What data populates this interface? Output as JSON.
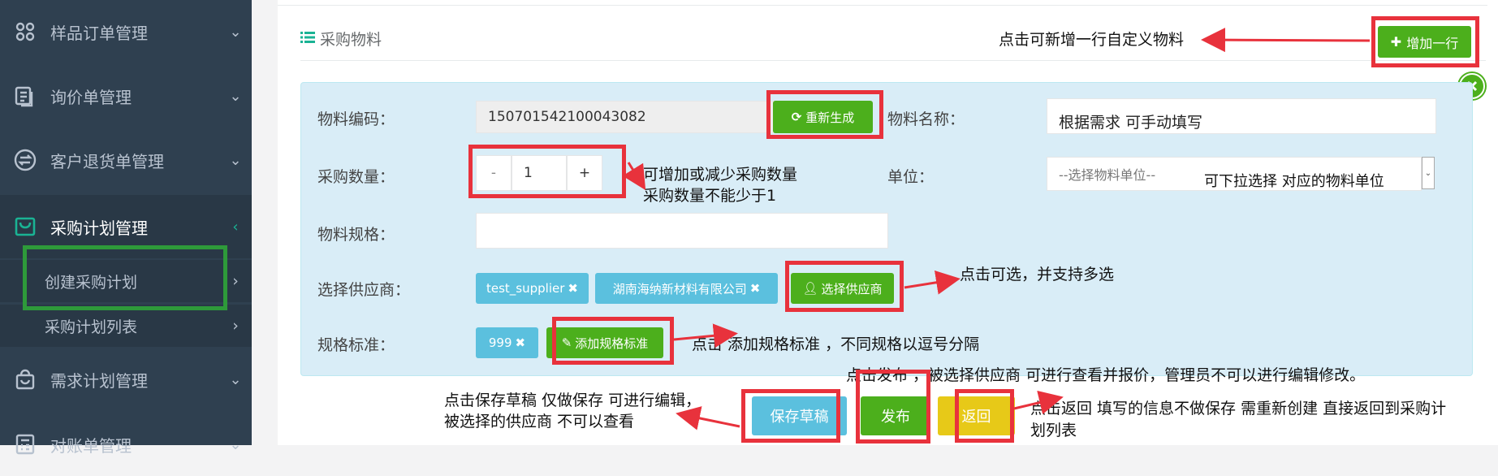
{
  "sidebar": {
    "items": [
      {
        "label": "样品订单管理",
        "icon": "command-icon"
      },
      {
        "label": "询价单管理",
        "icon": "document-icon"
      },
      {
        "label": "客户退货单管理",
        "icon": "exchange-icon"
      },
      {
        "label": "采购计划管理",
        "icon": "cart-icon"
      },
      {
        "label": "需求计划管理",
        "icon": "shopping-bag-icon"
      },
      {
        "label": "对账单管理",
        "icon": "calculator-icon"
      }
    ],
    "sub_items": [
      {
        "label": "创建采购计划"
      },
      {
        "label": "采购计划列表"
      }
    ]
  },
  "section": {
    "title": "采购物料",
    "icon": "list-icon"
  },
  "toolbar": {
    "add_row": "增加一行"
  },
  "form": {
    "code_label": "物料编码：",
    "code_value": "150701542100043082",
    "regenerate": "重新生成",
    "name_label": "物料名称：",
    "name_value": "根据需求 可手动填写",
    "qty_label": "采购数量：",
    "qty_minus": "-",
    "qty_value": "1",
    "qty_plus": "+",
    "unit_label": "单位：",
    "unit_placeholder": "--选择物料单位--",
    "spec_label": "物料规格：",
    "supplier_label": "选择供应商：",
    "suppliers": [
      "test_supplier",
      "湖南海纳新材料有限公司"
    ],
    "choose_supplier": "选择供应商",
    "standard_label": "规格标准：",
    "standards": [
      "999"
    ],
    "add_standard": "添加规格标准"
  },
  "actions": {
    "save_draft": "保存草稿",
    "publish": "发布",
    "back": "返回"
  },
  "notes": {
    "add_row": "点击可新增一行自定义物料",
    "qty_line1": "可增加或减少采购数量",
    "qty_line2": "采购数量不能少于1",
    "unit": "可下拉选择 对应的物料单位",
    "supplier": "点击可选，并支持多选",
    "standard": "点击 添加规格标准 ，不同规格以逗号分隔",
    "publish": "点击发布 ，被选择供应商 可进行查看并报价，管理员不可以进行编辑修改。",
    "draft_line1": "点击保存草稿 仅做保存 可进行编辑，",
    "draft_line2": "被选择的供应商 不可以查看",
    "back_line1": "点击返回 填写的信息不做保存 需重新创建 直接返回到采购计",
    "back_line2": "划列表"
  },
  "colors": {
    "sidebar": "#2f4050",
    "panel": "#d9edf7",
    "green": "#4caf1c",
    "info": "#5bc0de",
    "yellow": "#e7c918",
    "annotation_red": "#e8323c",
    "highlight_green": "#2e9a3a"
  }
}
